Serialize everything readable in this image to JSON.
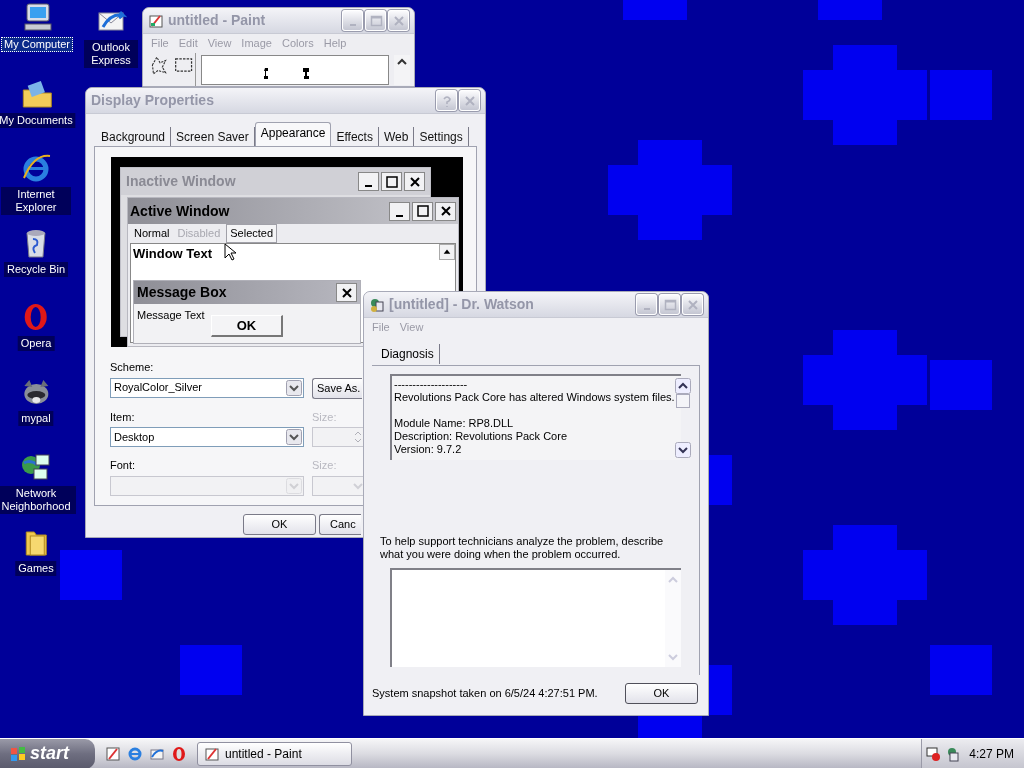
{
  "desktop_icons": [
    {
      "label": "My Computer",
      "selected": true
    },
    {
      "label": "Outlook Express",
      "selected": false
    },
    {
      "label": "My Documents",
      "selected": false
    },
    {
      "label": "Internet Explorer",
      "selected": false
    },
    {
      "label": "Recycle Bin",
      "selected": false
    },
    {
      "label": "Opera",
      "selected": false
    },
    {
      "label": "mypal",
      "selected": false
    },
    {
      "label": "Network Neighborhood",
      "selected": false
    },
    {
      "label": "Games",
      "selected": false
    }
  ],
  "paint_window": {
    "title": "untitled - Paint",
    "menu": [
      "File",
      "Edit",
      "View",
      "Image",
      "Colors",
      "Help"
    ]
  },
  "display_properties": {
    "title": "Display Properties",
    "tabs": [
      {
        "label": "Background",
        "selected": false
      },
      {
        "label": "Screen Saver",
        "selected": false
      },
      {
        "label": "Appearance",
        "selected": true
      },
      {
        "label": "Effects",
        "selected": false
      },
      {
        "label": "Web",
        "selected": false
      },
      {
        "label": "Settings",
        "selected": false
      }
    ],
    "preview": {
      "inactive_title": "Inactive Window",
      "active_title": "Active Window",
      "menu": [
        {
          "label": "Normal",
          "kind": "normal"
        },
        {
          "label": "Disabled",
          "kind": "disabled"
        },
        {
          "label": "Selected",
          "kind": "selected"
        }
      ],
      "window_text": "Window Text",
      "message_box_title": "Message Box",
      "message_text": "Message Text",
      "ok": "OK"
    },
    "scheme_label": "Scheme:",
    "scheme_value": "RoyalColor_Silver",
    "save_as": "Save As.",
    "item_label": "Item:",
    "item_value": "Desktop",
    "item_size_label": "Size:",
    "font_label": "Font:",
    "font_size_label": "Size:",
    "buttons": [
      "OK",
      "Canc"
    ]
  },
  "dr_watson": {
    "title": "[untitled] - Dr. Watson",
    "menu": [
      "File",
      "View"
    ],
    "tabs": [
      {
        "label": "Diagnosis",
        "selected": true
      }
    ],
    "log": [
      [
        "--------------------",
        "Revolutions Pack Core has altered Windows system files."
      ],
      [
        "Module Name: RP8.DLL",
        "Description: Revolutions Pack Core",
        "Version: 9.7.2"
      ]
    ],
    "prompt": "To help support technicians analyze the problem, describe what you were doing when the problem occurred.",
    "status": "System snapshot taken on 6/5/24 4:27:51 PM.",
    "ok": "OK"
  },
  "taskbar": {
    "start": "start",
    "tasks": [
      {
        "label": "untitled - Paint",
        "selected": false
      }
    ],
    "clock": "4:27 PM"
  }
}
